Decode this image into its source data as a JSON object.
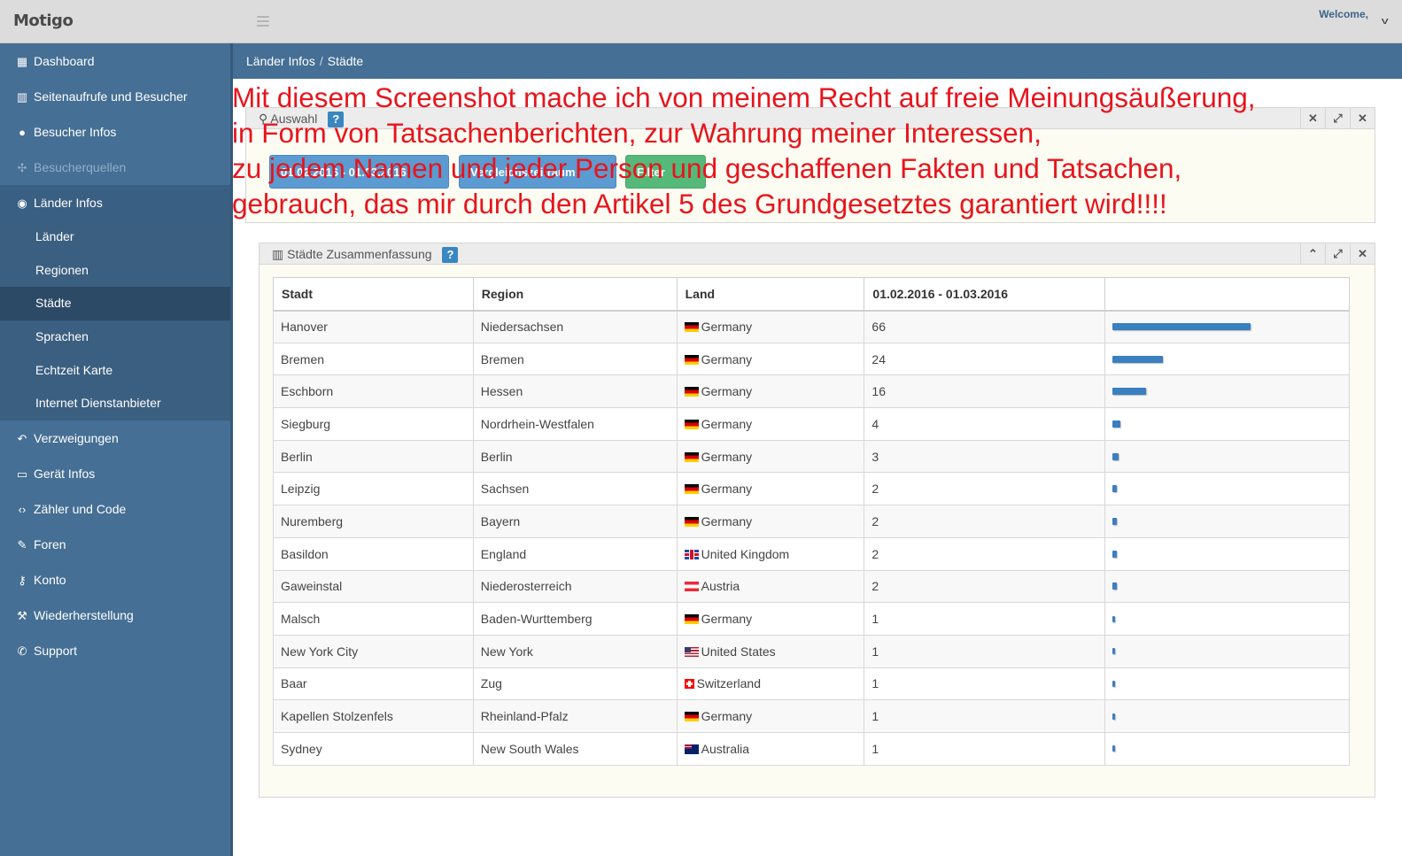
{
  "app": {
    "brand": "Motigo",
    "welcome": "Welcome,"
  },
  "sidebar": {
    "items": [
      {
        "label": "Dashboard",
        "icon": "table-icon"
      },
      {
        "label": "Seitenaufrufe und Besucher",
        "icon": "bar-chart-icon"
      },
      {
        "label": "Besucher Infos",
        "icon": "user-icon"
      },
      {
        "label": "Besucherquellen",
        "icon": "puzzle-icon",
        "disabled": true
      },
      {
        "label": "Länder Infos",
        "icon": "globe-icon",
        "active": true
      },
      {
        "label": "Verzweigungen",
        "icon": "reply-all-icon"
      },
      {
        "label": "Gerät Infos",
        "icon": "monitor-icon"
      },
      {
        "label": "Zähler und Code",
        "icon": "code-icon"
      },
      {
        "label": "Foren",
        "icon": "edit-icon"
      },
      {
        "label": "Konto",
        "icon": "key-icon"
      },
      {
        "label": "Wiederherstellung",
        "icon": "wrench-icon"
      },
      {
        "label": "Support",
        "icon": "phone-icon"
      }
    ],
    "submenu": [
      {
        "label": "Länder"
      },
      {
        "label": "Regionen"
      },
      {
        "label": "Städte",
        "active": true
      },
      {
        "label": "Sprachen"
      },
      {
        "label": "Echtzeit Karte"
      },
      {
        "label": "Internet Dienstanbieter"
      }
    ]
  },
  "breadcrumb": {
    "parent": "Länder Infos",
    "separator": "/",
    "current": "Städte"
  },
  "auswahl": {
    "title": "Auswahl",
    "help": "?",
    "date_button": "01.02.2016 - 01.03.2016",
    "compare_button": "Vergleichszeitraum",
    "green_button": "Filter"
  },
  "summary": {
    "title": "Städte Zusammenfassung",
    "help": "?",
    "columns": [
      "Stadt",
      "Region",
      "Land",
      "01.02.2016 - 01.03.2016",
      ""
    ],
    "rows": [
      {
        "city": "Hanover",
        "region": "Niedersachsen",
        "country": "Germany",
        "flag": "de",
        "count": "66"
      },
      {
        "city": "Bremen",
        "region": "Bremen",
        "country": "Germany",
        "flag": "de",
        "count": "24"
      },
      {
        "city": "Eschborn",
        "region": "Hessen",
        "country": "Germany",
        "flag": "de",
        "count": "16"
      },
      {
        "city": "Siegburg",
        "region": "Nordrhein-Westfalen",
        "country": "Germany",
        "flag": "de",
        "count": "4"
      },
      {
        "city": "Berlin",
        "region": "Berlin",
        "country": "Germany",
        "flag": "de",
        "count": "3"
      },
      {
        "city": "Leipzig",
        "region": "Sachsen",
        "country": "Germany",
        "flag": "de",
        "count": "2"
      },
      {
        "city": "Nuremberg",
        "region": "Bayern",
        "country": "Germany",
        "flag": "de",
        "count": "2"
      },
      {
        "city": "Basildon",
        "region": "England",
        "country": "United Kingdom",
        "flag": "gb",
        "count": "2"
      },
      {
        "city": "Gaweinstal",
        "region": "Niederosterreich",
        "country": "Austria",
        "flag": "at",
        "count": "2"
      },
      {
        "city": "Malsch",
        "region": "Baden-Wurttemberg",
        "country": "Germany",
        "flag": "de",
        "count": "1"
      },
      {
        "city": "New York City",
        "region": "New York",
        "country": "United States",
        "flag": "us",
        "count": "1"
      },
      {
        "city": "Baar",
        "region": "Zug",
        "country": "Switzerland",
        "flag": "ch",
        "count": "1"
      },
      {
        "city": "Kapellen Stolzenfels",
        "region": "Rheinland-Pfalz",
        "country": "Germany",
        "flag": "de",
        "count": "1"
      },
      {
        "city": "Sydney",
        "region": "New South Wales",
        "country": "Australia",
        "flag": "au",
        "count": "1"
      }
    ]
  },
  "overlay": {
    "lines": [
      "Mit diesem Screenshot mache ich von meinem Recht auf freie Meinungsäußerung,",
      "in Form von Tatsachenberichten, zur Wahrung meiner Interessen,",
      "zu jedem Namen und jeder Person und geschaffenen Fakten und Tatsachen,",
      "gebrauch, das mir durch den Artikel 5 des Grundgesetztes garantiert wird!!!!"
    ]
  },
  "colors": {
    "sidebar": "#456f94",
    "accent": "#3a87c0",
    "overlay_text": "#e8141c",
    "bar": "#3a7fc0"
  }
}
